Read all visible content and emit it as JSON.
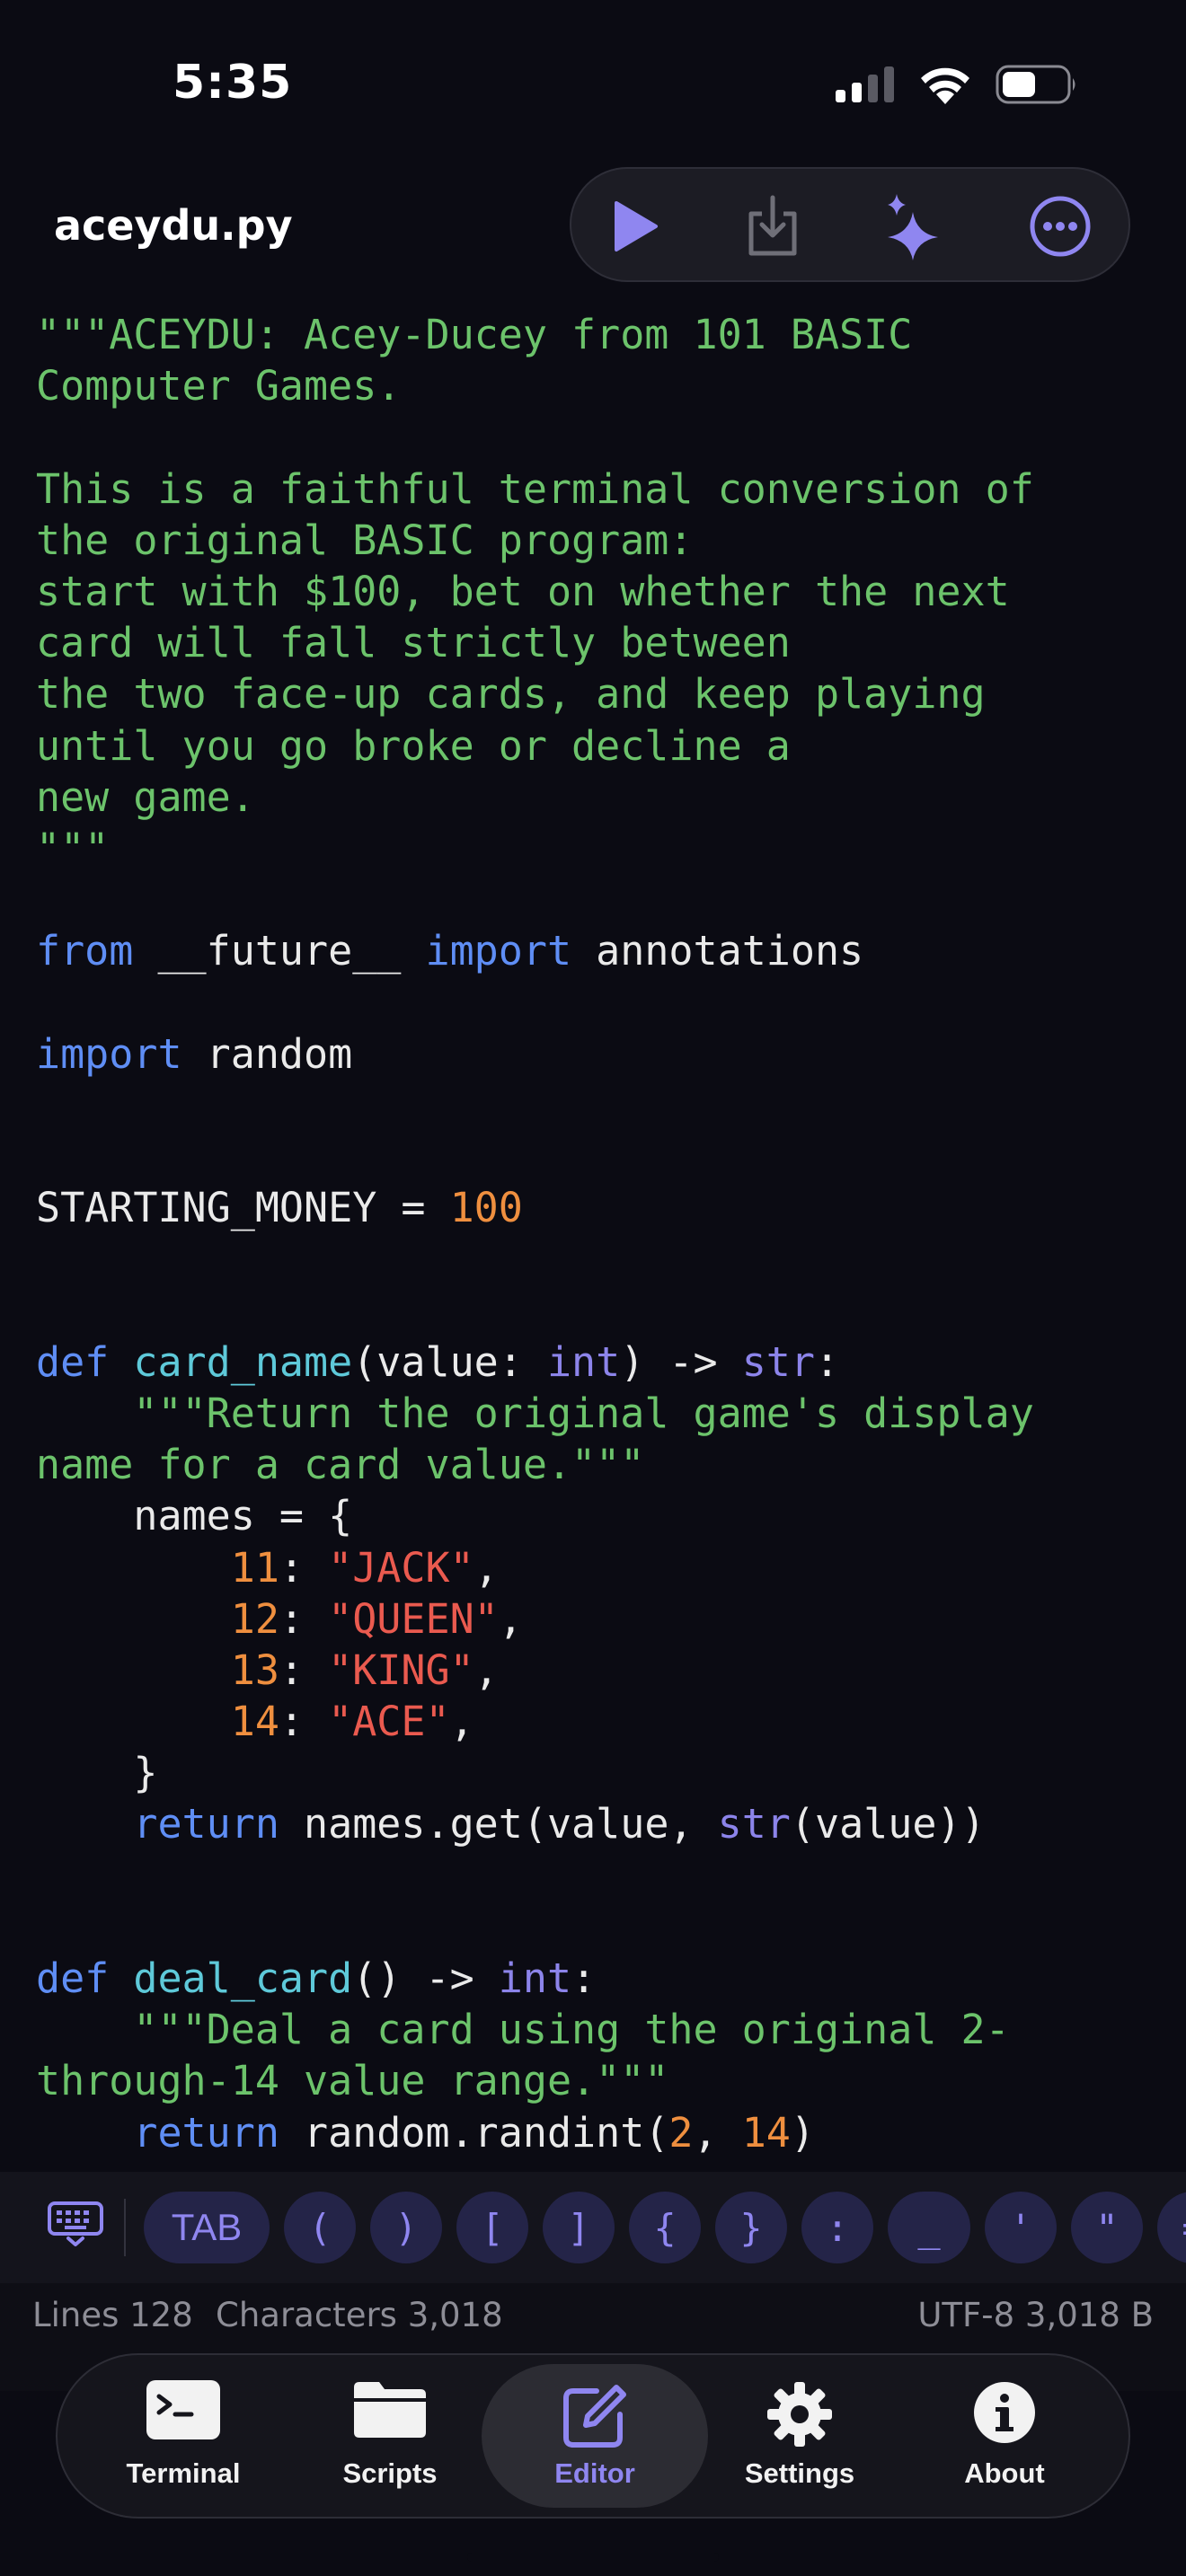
{
  "status_bar": {
    "time": "5:35"
  },
  "header": {
    "file_name": "aceydu.py"
  },
  "toolbar": {
    "icons": [
      "run-icon",
      "download-icon",
      "sparkle-icon",
      "more-icon"
    ]
  },
  "code_lines": [
    [
      {
        "c": "cm",
        "t": "\"\"\"ACEYDU: Acey-Ducey from 101 BASIC"
      }
    ],
    [
      {
        "c": "cm",
        "t": "Computer Games."
      }
    ],
    [],
    [
      {
        "c": "cm",
        "t": "This is a faithful terminal conversion of"
      }
    ],
    [
      {
        "c": "cm",
        "t": "the original BASIC program:"
      }
    ],
    [
      {
        "c": "cm",
        "t": "start with $100, bet on whether the next"
      }
    ],
    [
      {
        "c": "cm",
        "t": "card will fall strictly between"
      }
    ],
    [
      {
        "c": "cm",
        "t": "the two face-up cards, and keep playing"
      }
    ],
    [
      {
        "c": "cm",
        "t": "until you go broke or decline a"
      }
    ],
    [
      {
        "c": "cm",
        "t": "new game."
      }
    ],
    [
      {
        "c": "cm",
        "t": "\"\"\""
      }
    ],
    [],
    [
      {
        "c": "kw",
        "t": "from"
      },
      {
        "c": "",
        "t": " __future__ "
      },
      {
        "c": "kw",
        "t": "import"
      },
      {
        "c": "",
        "t": " annotations"
      }
    ],
    [],
    [
      {
        "c": "kw",
        "t": "import"
      },
      {
        "c": "",
        "t": " random"
      }
    ],
    [],
    [],
    [
      {
        "c": "",
        "t": "STARTING_MONEY = "
      },
      {
        "c": "num",
        "t": "100"
      }
    ],
    [],
    [],
    [
      {
        "c": "kw",
        "t": "def"
      },
      {
        "c": "",
        "t": " "
      },
      {
        "c": "fn",
        "t": "card_name"
      },
      {
        "c": "",
        "t": "(value: "
      },
      {
        "c": "bi",
        "t": "int"
      },
      {
        "c": "",
        "t": ") -> "
      },
      {
        "c": "bi",
        "t": "str"
      },
      {
        "c": "",
        "t": ":"
      }
    ],
    [
      {
        "c": "",
        "t": "    "
      },
      {
        "c": "cm",
        "t": "\"\"\"Return the original game's display"
      }
    ],
    [
      {
        "c": "cm",
        "t": "name for a card value.\"\"\""
      }
    ],
    [
      {
        "c": "",
        "t": "    names = {"
      }
    ],
    [
      {
        "c": "",
        "t": "        "
      },
      {
        "c": "num",
        "t": "11"
      },
      {
        "c": "",
        "t": ": "
      },
      {
        "c": "str",
        "t": "\"JACK\""
      },
      {
        "c": "",
        "t": ","
      }
    ],
    [
      {
        "c": "",
        "t": "        "
      },
      {
        "c": "num",
        "t": "12"
      },
      {
        "c": "",
        "t": ": "
      },
      {
        "c": "str",
        "t": "\"QUEEN\""
      },
      {
        "c": "",
        "t": ","
      }
    ],
    [
      {
        "c": "",
        "t": "        "
      },
      {
        "c": "num",
        "t": "13"
      },
      {
        "c": "",
        "t": ": "
      },
      {
        "c": "str",
        "t": "\"KING\""
      },
      {
        "c": "",
        "t": ","
      }
    ],
    [
      {
        "c": "",
        "t": "        "
      },
      {
        "c": "num",
        "t": "14"
      },
      {
        "c": "",
        "t": ": "
      },
      {
        "c": "str",
        "t": "\"ACE\""
      },
      {
        "c": "",
        "t": ","
      }
    ],
    [
      {
        "c": "",
        "t": "    }"
      }
    ],
    [
      {
        "c": "",
        "t": "    "
      },
      {
        "c": "kw",
        "t": "return"
      },
      {
        "c": "",
        "t": " names.get(value, "
      },
      {
        "c": "bi",
        "t": "str"
      },
      {
        "c": "",
        "t": "(value))"
      }
    ],
    [],
    [],
    [
      {
        "c": "kw",
        "t": "def"
      },
      {
        "c": "",
        "t": " "
      },
      {
        "c": "fn",
        "t": "deal_card"
      },
      {
        "c": "",
        "t": "() -> "
      },
      {
        "c": "bi",
        "t": "int"
      },
      {
        "c": "",
        "t": ":"
      }
    ],
    [
      {
        "c": "",
        "t": "    "
      },
      {
        "c": "cm",
        "t": "\"\"\"Deal a card using the original 2-"
      }
    ],
    [
      {
        "c": "cm",
        "t": "through-14 value range.\"\"\""
      }
    ],
    [
      {
        "c": "",
        "t": "    "
      },
      {
        "c": "kw",
        "t": "return"
      },
      {
        "c": "",
        "t": " random.randint("
      },
      {
        "c": "num",
        "t": "2"
      },
      {
        "c": "",
        "t": ", "
      },
      {
        "c": "num",
        "t": "14"
      },
      {
        "c": "",
        "t": ")"
      }
    ]
  ],
  "keybar": {
    "keys": [
      "TAB",
      "(",
      ")",
      "[",
      "]",
      "{",
      "}",
      ":",
      "_",
      "'",
      "\"",
      "="
    ]
  },
  "infobar": {
    "lines": "Lines 128",
    "characters": "Characters 3,018",
    "encoding": "UTF-8 3,018 B"
  },
  "tabs": [
    {
      "label": "Terminal",
      "icon": "terminal-icon",
      "active": false
    },
    {
      "label": "Scripts",
      "icon": "folder-icon",
      "active": false
    },
    {
      "label": "Editor",
      "icon": "edit-icon",
      "active": true
    },
    {
      "label": "Settings",
      "icon": "gear-icon",
      "active": false
    },
    {
      "label": "About",
      "icon": "info-icon",
      "active": false
    }
  ],
  "colors": {
    "background": "#0b0b13",
    "accent": "#8f86f0",
    "comment": "#6cc36b",
    "keyword": "#5f8ef5",
    "function": "#5ec9d9",
    "number": "#ef8f3f",
    "string": "#ea5a4f"
  }
}
